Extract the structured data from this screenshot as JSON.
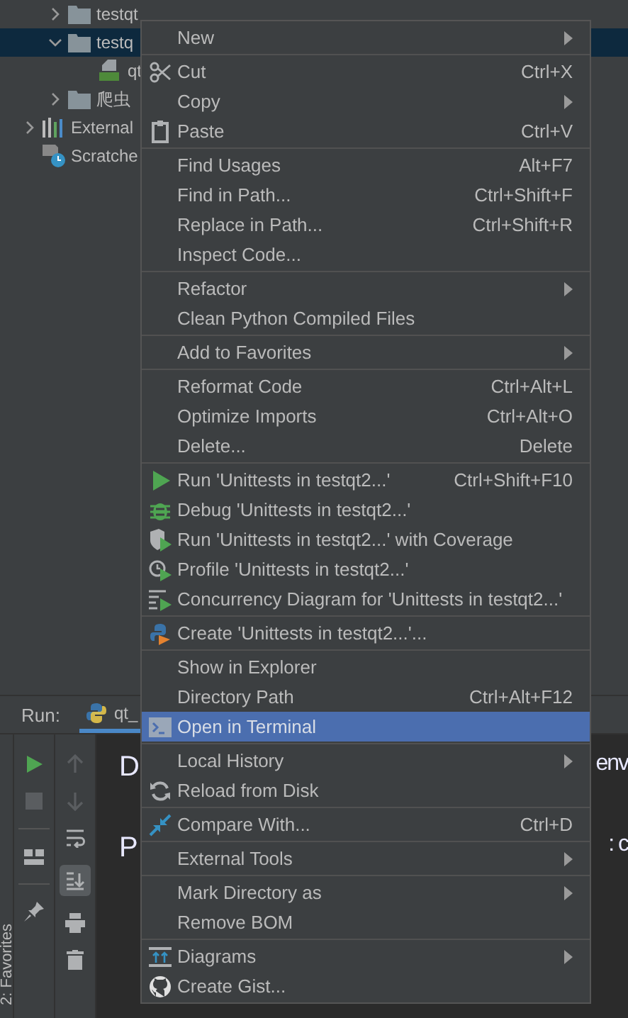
{
  "project_tree": {
    "nested_items": [
      {
        "label": "testqt",
        "kind": "folder",
        "expanded": false,
        "selected": false
      },
      {
        "label": "testq",
        "kind": "folder",
        "expanded": true,
        "selected": true,
        "children": [
          {
            "label": "qt",
            "kind": "qt-file",
            "selected": false
          }
        ]
      },
      {
        "label": "爬虫",
        "kind": "folder",
        "expanded": false,
        "selected": false
      }
    ],
    "top_items": [
      {
        "label": "External",
        "kind": "libraries",
        "expanded": false
      },
      {
        "label": "Scratche",
        "kind": "scratches"
      }
    ]
  },
  "context_menu": {
    "groups": [
      [
        {
          "label": "New",
          "submenu": true,
          "selected": false
        }
      ],
      [
        {
          "label": "Cut",
          "shortcut": "Ctrl+X",
          "submenu": false,
          "selected": false
        },
        {
          "label": "Copy",
          "submenu": true,
          "selected": false
        },
        {
          "label": "Paste",
          "shortcut": "Ctrl+V",
          "submenu": false,
          "selected": false
        }
      ],
      [
        {
          "label": "Find Usages",
          "shortcut": "Alt+F7",
          "submenu": false,
          "selected": false
        },
        {
          "label": "Find in Path...",
          "shortcut": "Ctrl+Shift+F",
          "submenu": false,
          "selected": false
        },
        {
          "label": "Replace in Path...",
          "shortcut": "Ctrl+Shift+R",
          "submenu": false,
          "selected": false
        },
        {
          "label": "Inspect Code...",
          "submenu": false,
          "selected": false
        }
      ],
      [
        {
          "label": "Refactor",
          "submenu": true,
          "selected": false
        },
        {
          "label": "Clean Python Compiled Files",
          "submenu": false,
          "selected": false
        }
      ],
      [
        {
          "label": "Add to Favorites",
          "submenu": true,
          "selected": false
        }
      ],
      [
        {
          "label": "Reformat Code",
          "shortcut": "Ctrl+Alt+L",
          "submenu": false,
          "selected": false
        },
        {
          "label": "Optimize Imports",
          "shortcut": "Ctrl+Alt+O",
          "submenu": false,
          "selected": false
        },
        {
          "label": "Delete...",
          "shortcut": "Delete",
          "submenu": false,
          "selected": false
        }
      ],
      [
        {
          "label": "Run 'Unittests in testqt2...'",
          "shortcut": "Ctrl+Shift+F10",
          "submenu": false,
          "selected": false
        },
        {
          "label": "Debug 'Unittests in testqt2...'",
          "submenu": false,
          "selected": false
        },
        {
          "label": "Run 'Unittests in testqt2...' with Coverage",
          "submenu": false,
          "selected": false
        },
        {
          "label": "Profile 'Unittests in testqt2...'",
          "submenu": false,
          "selected": false
        },
        {
          "label": "Concurrency Diagram for 'Unittests in testqt2...'",
          "submenu": false,
          "selected": false
        }
      ],
      [
        {
          "label": "Create 'Unittests in testqt2...'...",
          "submenu": false,
          "selected": false
        }
      ],
      [
        {
          "label": "Show in Explorer",
          "submenu": false,
          "selected": false
        },
        {
          "label": "Directory Path",
          "shortcut": "Ctrl+Alt+F12",
          "submenu": false,
          "selected": false
        },
        {
          "label": "Open in Terminal",
          "submenu": false,
          "selected": true
        }
      ],
      [
        {
          "label": "Local History",
          "submenu": true,
          "selected": false
        },
        {
          "label": "Reload from Disk",
          "submenu": false,
          "selected": false
        }
      ],
      [
        {
          "label": "Compare With...",
          "shortcut": "Ctrl+D",
          "submenu": false,
          "selected": false
        }
      ],
      [
        {
          "label": "External Tools",
          "submenu": true,
          "selected": false
        }
      ],
      [
        {
          "label": "Mark Directory as",
          "submenu": true,
          "selected": false
        },
        {
          "label": "Remove BOM",
          "submenu": false,
          "selected": false
        }
      ],
      [
        {
          "label": "Diagrams",
          "submenu": true,
          "selected": false
        },
        {
          "label": "Create Gist...",
          "submenu": false,
          "selected": false
        }
      ]
    ]
  },
  "run_panel": {
    "label": "Run:",
    "tab": "qt_",
    "console_lines": [
      {
        "left": "D",
        "right": "env"
      },
      {
        "left": "P",
        "right": ": c"
      }
    ]
  },
  "side_bar": {
    "label": "2: Favorites"
  }
}
